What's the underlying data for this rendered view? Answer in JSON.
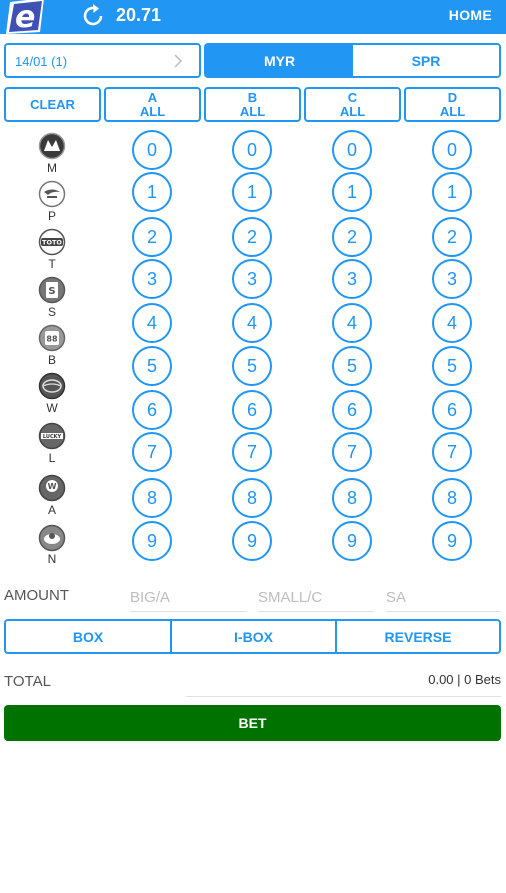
{
  "header": {
    "balance": "20.71",
    "home_label": "HOME",
    "logo_icon": "e-logo",
    "refresh_icon": "refresh-icon",
    "brand_color": "#2196f3"
  },
  "date_select": {
    "value": "14/01 (1)",
    "icon": "chevron-right-icon"
  },
  "currency": {
    "options": [
      "MYR",
      "SPR"
    ],
    "selected": "MYR"
  },
  "positions": {
    "clear_label": "CLEAR",
    "columns": [
      {
        "letter": "A",
        "all": "ALL"
      },
      {
        "letter": "B",
        "all": "ALL"
      },
      {
        "letter": "C",
        "all": "ALL"
      },
      {
        "letter": "D",
        "all": "ALL"
      }
    ]
  },
  "providers": [
    {
      "code": "M",
      "icon": "magnum-icon"
    },
    {
      "code": "P",
      "icon": "damacai-icon"
    },
    {
      "code": "T",
      "icon": "toto-icon"
    },
    {
      "code": "S",
      "icon": "singapore-icon"
    },
    {
      "code": "B",
      "icon": "sabah-icon"
    },
    {
      "code": "W",
      "icon": "sandakan-icon"
    },
    {
      "code": "L",
      "icon": "lucky-icon"
    },
    {
      "code": "A",
      "icon": "perdana-icon"
    },
    {
      "code": "N",
      "icon": "lottery-icon"
    }
  ],
  "digits": [
    "0",
    "1",
    "2",
    "3",
    "4",
    "5",
    "6",
    "7",
    "8",
    "9"
  ],
  "amount": {
    "label": "AMOUNT",
    "big_placeholder": "BIG/A",
    "small_placeholder": "SMALL/C",
    "sa_placeholder": "SA"
  },
  "bet_types": [
    "BOX",
    "I-BOX",
    "REVERSE"
  ],
  "total": {
    "label": "TOTAL",
    "value": "0.00 | 0 Bets"
  },
  "bet_button": {
    "label": "BET",
    "color": "#007200"
  }
}
